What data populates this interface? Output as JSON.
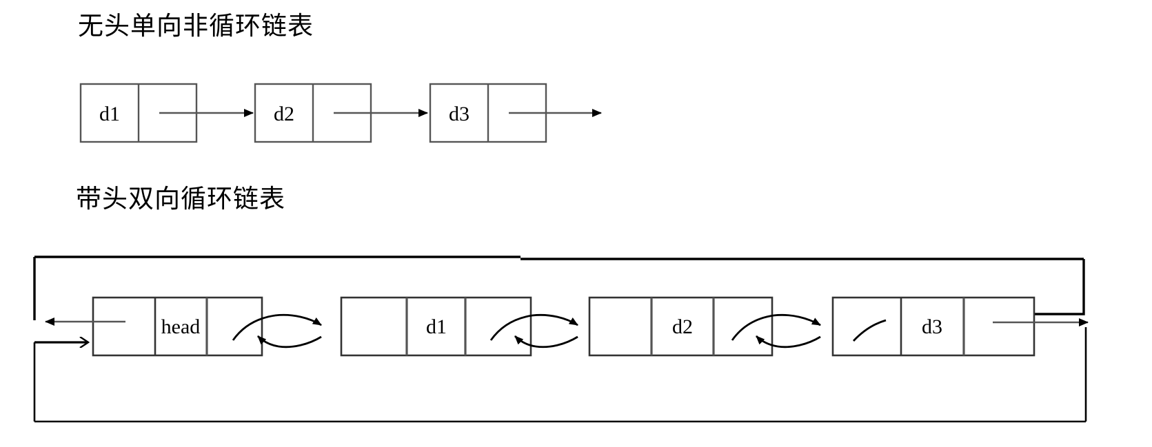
{
  "diagrams": [
    {
      "id": "singly-linked-list",
      "title": "无头单向非循环链表",
      "nodes": [
        {
          "data": "d1"
        },
        {
          "data": "d2"
        },
        {
          "data": "d3"
        }
      ]
    },
    {
      "id": "doubly-circular-linked-list",
      "title": "带头双向循环链表",
      "nodes": [
        {
          "data": "head"
        },
        {
          "data": "d1"
        },
        {
          "data": "d2"
        },
        {
          "data": "d3"
        }
      ]
    }
  ],
  "colors": {
    "stroke": "#000000",
    "pointer_line": "#444444",
    "background": "#ffffff"
  }
}
